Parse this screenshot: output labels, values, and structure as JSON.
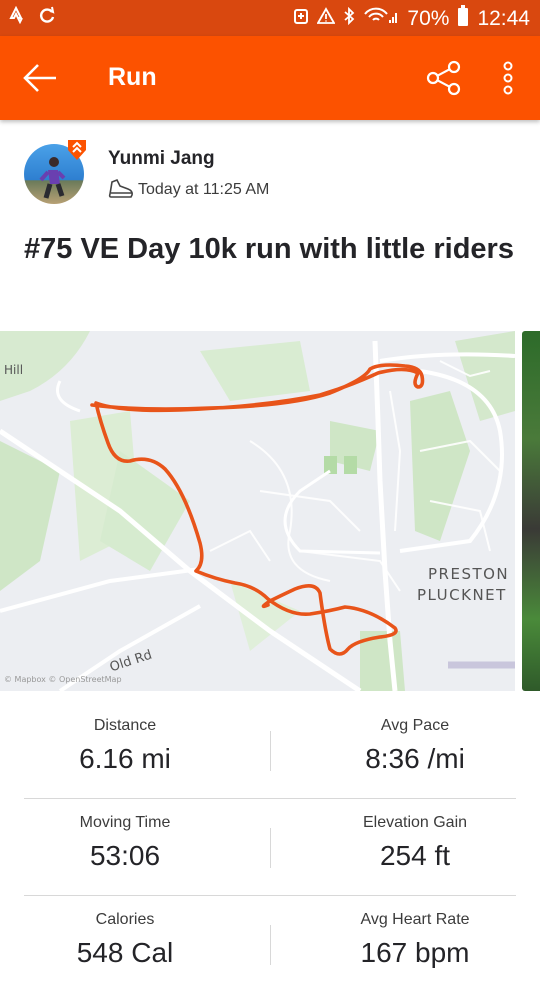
{
  "status_bar": {
    "battery": "70%",
    "time": "12:44"
  },
  "app_bar": {
    "title": "Run",
    "back_icon": "arrow-left-icon",
    "share_icon": "share-icon",
    "more_icon": "more-vertical-icon"
  },
  "activity": {
    "athlete_name": "Yunmi Jang",
    "time_text": "Today at 11:25 AM",
    "title": "#75 VE Day 10k run with little riders"
  },
  "map": {
    "labels": {
      "hill": "Hill",
      "place_line1": "PRESTON",
      "place_line2": "PLUCKNET",
      "road": "Old Rd",
      "attribution": "© Mapbox © OpenStreetMap"
    },
    "route_color": "#e8541a"
  },
  "stats": [
    {
      "label": "Distance",
      "value": "6.16 mi"
    },
    {
      "label": "Avg Pace",
      "value": "8:36 /mi"
    },
    {
      "label": "Moving Time",
      "value": "53:06"
    },
    {
      "label": "Elevation Gain",
      "value": "254 ft"
    },
    {
      "label": "Calories",
      "value": "548 Cal"
    },
    {
      "label": "Avg Heart Rate",
      "value": "167 bpm"
    }
  ],
  "colors": {
    "brand": "#fc5200",
    "status_bar": "#d9480f"
  }
}
